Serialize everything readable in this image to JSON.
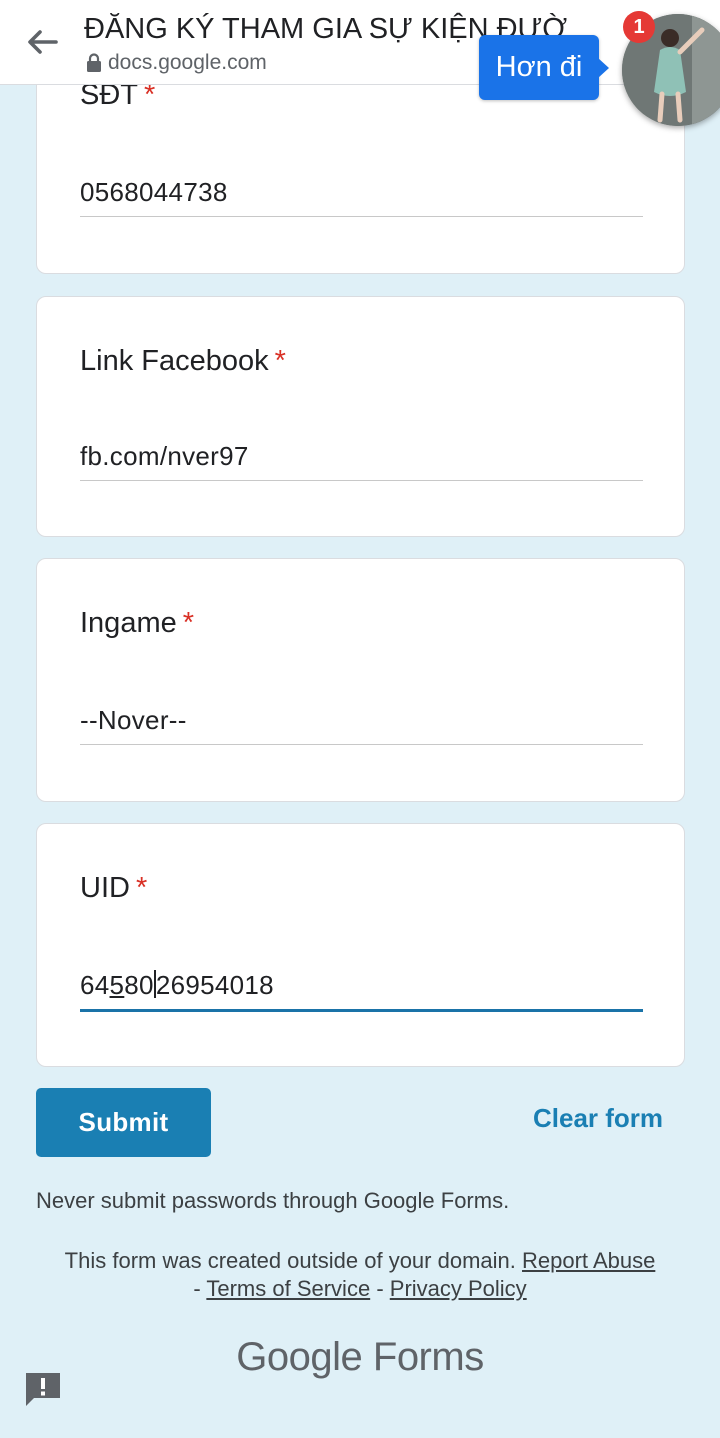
{
  "browser": {
    "title": "ĐĂNG KÝ THAM GIA SỰ KIỆN ĐƯỜ",
    "url": "docs.google.com",
    "icons": {
      "back": "back-arrow-icon",
      "lock": "lock-icon"
    }
  },
  "chat_head": {
    "message": "Hơn đi",
    "badge_count": "1"
  },
  "form": {
    "required_mark": "*",
    "questions": [
      {
        "label": "SĐT",
        "value": "0568044738"
      },
      {
        "label": "Link Facebook",
        "value": "fb.com/nver97"
      },
      {
        "label": "Ingame",
        "value": "--Nover--"
      },
      {
        "label": "UID",
        "value_parts": [
          "64",
          "5",
          "80",
          "26954018"
        ]
      }
    ],
    "submit_label": "Submit",
    "clear_label": "Clear form",
    "password_warning": "Never submit passwords through Google Forms.",
    "footer": {
      "prefix": "This form was created outside of your domain.",
      "report_abuse": "Report Abuse",
      "sep1": "-",
      "terms": "Terms of Service",
      "sep2": "-",
      "privacy": "Privacy Policy"
    },
    "brand": "Google Forms"
  },
  "colors": {
    "background": "#dff0f7",
    "accent": "#1a7fb3",
    "required": "#d93025",
    "chat_bubble": "#1a73e8",
    "badge": "#e53935"
  }
}
